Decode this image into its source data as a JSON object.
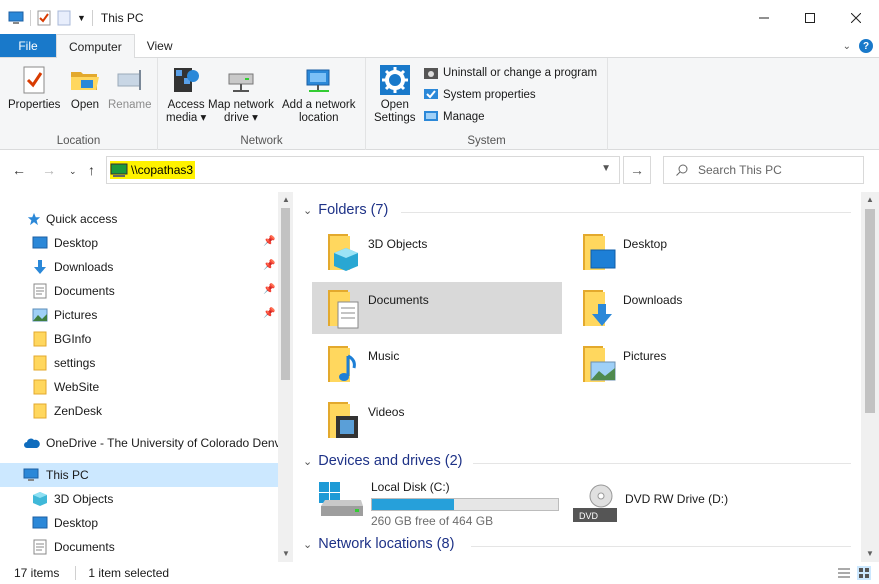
{
  "window": {
    "title": "This PC"
  },
  "tabs": {
    "file": "File",
    "computer": "Computer",
    "view": "View"
  },
  "ribbon": {
    "location": {
      "label": "Location",
      "properties": "Properties",
      "open": "Open",
      "rename": "Rename"
    },
    "network": {
      "label": "Network",
      "access_media_1": "Access",
      "access_media_2": "media ▾",
      "map_drive_1": "Map network",
      "map_drive_2": "drive ▾",
      "add_location_1": "Add a network",
      "add_location_2": "location"
    },
    "system": {
      "label": "System",
      "open_settings_1": "Open",
      "open_settings_2": "Settings",
      "uninstall": "Uninstall or change a program",
      "system_properties": "System properties",
      "manage": "Manage"
    }
  },
  "address": {
    "value": "\\\\copathas3",
    "search_placeholder": "Search This PC"
  },
  "nav": {
    "quick_access": "Quick access",
    "items": [
      "Desktop",
      "Downloads",
      "Documents",
      "Pictures",
      "BGInfo",
      "settings",
      "WebSite",
      "ZenDesk"
    ],
    "onedrive": "OneDrive - The University of Colorado Denv",
    "this_pc": "This PC",
    "pc_items": [
      "3D Objects",
      "Desktop",
      "Documents"
    ]
  },
  "content": {
    "folders_header": "Folders (7)",
    "folders": [
      "3D Objects",
      "Desktop",
      "Documents",
      "Downloads",
      "Music",
      "Pictures",
      "Videos"
    ],
    "devices_header": "Devices and drives (2)",
    "local_disk": {
      "name": "Local Disk (C:)",
      "free": "260 GB free of 464 GB",
      "used_fraction": 0.44
    },
    "dvd": {
      "name": "DVD RW Drive (D:)",
      "label": "DVD"
    },
    "network_header": "Network locations (8)"
  },
  "status": {
    "count": "17 items",
    "selected": "1 item selected"
  }
}
